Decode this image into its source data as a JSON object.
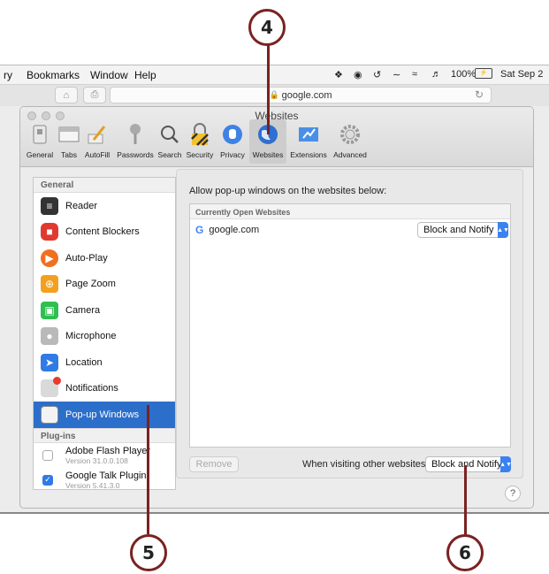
{
  "callouts": {
    "c4": "4",
    "c5": "5",
    "c6": "6"
  },
  "menubar": {
    "items": [
      "ry",
      "Bookmarks",
      "Window",
      "Help"
    ],
    "battery": "100%",
    "clock": "Sat Sep 2"
  },
  "toolbar": {
    "url": "google.com"
  },
  "window": {
    "title": "Websites",
    "tabs": [
      "General",
      "Tabs",
      "AutoFill",
      "Passwords",
      "Search",
      "Security",
      "Privacy",
      "Websites",
      "Extensions",
      "Advanced"
    ]
  },
  "sidebar": {
    "general_header": "General",
    "items": [
      {
        "label": "Reader",
        "icon": "reader-icon"
      },
      {
        "label": "Content Blockers",
        "icon": "stop-icon"
      },
      {
        "label": "Auto-Play",
        "icon": "play-icon"
      },
      {
        "label": "Page Zoom",
        "icon": "zoom-icon"
      },
      {
        "label": "Camera",
        "icon": "camera-icon"
      },
      {
        "label": "Microphone",
        "icon": "microphone-icon"
      },
      {
        "label": "Location",
        "icon": "location-icon"
      },
      {
        "label": "Notifications",
        "icon": "notification-icon"
      },
      {
        "label": "Pop-up Windows",
        "icon": "popup-window-icon"
      }
    ],
    "plugins_header": "Plug-ins",
    "plugins": [
      {
        "name": "Adobe Flash Player",
        "version": "Version 31.0.0.108",
        "checked": false
      },
      {
        "name": "Google Talk Plugin",
        "version": "Version 5.41.3.0",
        "checked": true
      }
    ]
  },
  "panel": {
    "allow_text": "Allow pop-up windows on the websites below:",
    "list_header": "Currently Open Websites",
    "site": {
      "name": "google.com",
      "setting": "Block and Notify"
    },
    "remove_label": "Remove",
    "other_label": "When visiting other websites:",
    "other_setting": "Block and Notify"
  },
  "help_label": "?"
}
